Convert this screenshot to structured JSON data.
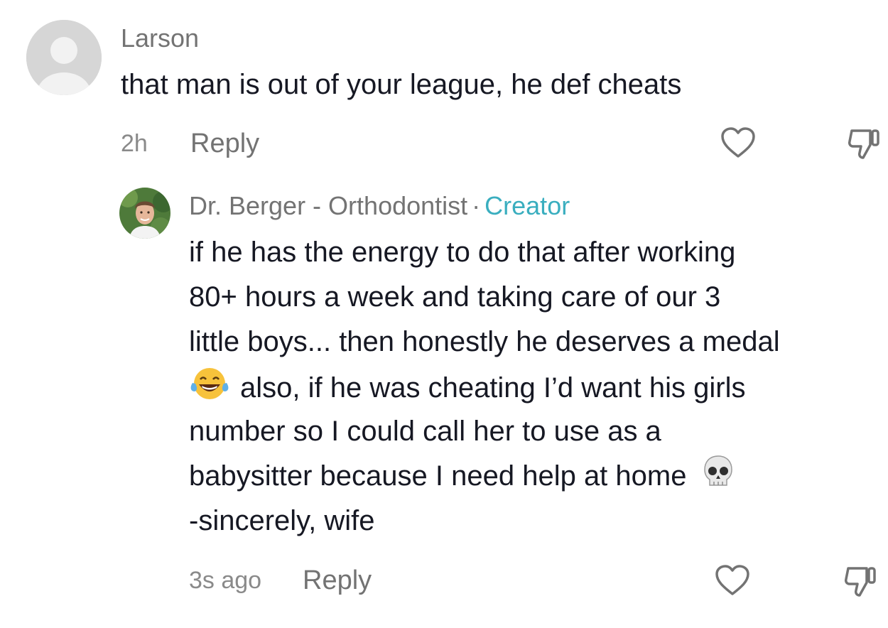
{
  "comment": {
    "username": "Larson",
    "text": "that man is out of your league, he def cheats",
    "time": "2h",
    "reply_label": "Reply",
    "icons": [
      "default-avatar-icon",
      "heart-outline-icon",
      "thumbs-down-outline-icon"
    ]
  },
  "reply": {
    "username": "Dr. Berger - Orthodontist",
    "separator": "·",
    "badge": "Creator",
    "lines": [
      "if he has the energy to do that after working",
      "80+ hours a week and taking care of our 3",
      "little boys... then honestly he deserves a medal",
      "also, if he was cheating I’d want his girls",
      "number so I could call her to use as a",
      "babysitter because I need help at home",
      "-sincerely, wife"
    ],
    "time": "3s ago",
    "reply_label": "Reply",
    "icons": [
      "profile-photo",
      "laughing-tears-emoji-icon",
      "skull-emoji-icon",
      "heart-outline-icon",
      "thumbs-down-outline-icon"
    ]
  },
  "colors": {
    "text": "#161823",
    "muted": "#737373",
    "creator_badge": "#3aaebf",
    "avatar_placeholder": "#d8d8d8"
  }
}
